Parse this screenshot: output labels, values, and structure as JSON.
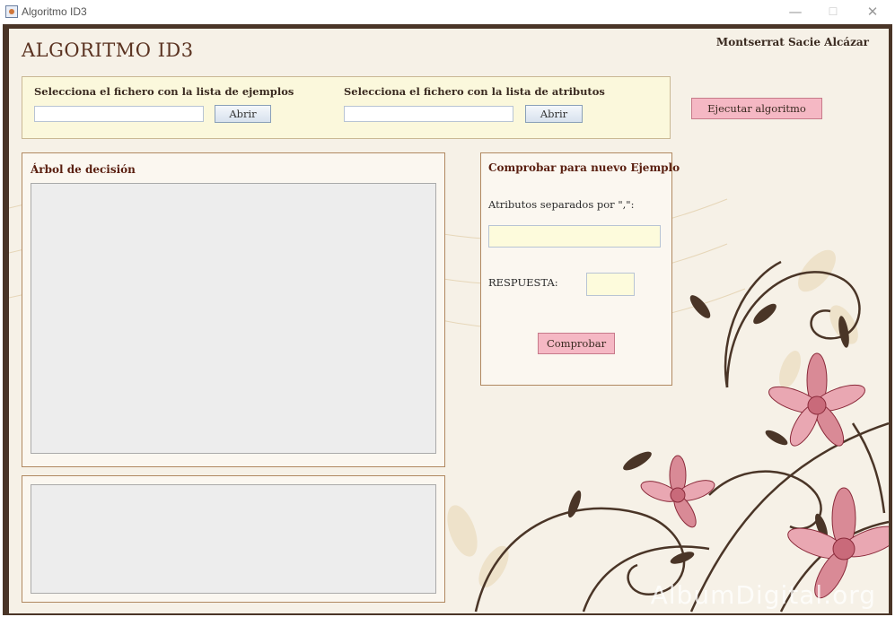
{
  "window": {
    "title": "Algoritmo ID3",
    "minimize": "—",
    "maximize": "☐",
    "close": "✕"
  },
  "app": {
    "title": "ALGORITMO ID3",
    "author": "Montserrat Sacie Alcázar"
  },
  "files": {
    "examples_label": "Selecciona el fichero  con la lista de ejemplos",
    "examples_value": "",
    "attributes_label": "Selecciona el fichero  con la lista de atributos",
    "attributes_value": "",
    "open_label": "Abrir"
  },
  "run_button": "Ejecutar algoritmo",
  "tree_panel": {
    "title": "Árbol de decisión"
  },
  "check_panel": {
    "title": "Comprobar para nuevo Ejemplo",
    "attributes_label": "Atributos separados por \",\":",
    "attributes_value": "",
    "answer_label": "RESPUESTA:",
    "answer_value": "",
    "check_button": "Comprobar"
  },
  "watermark": "AlbumDigital.org",
  "colors": {
    "frame": "#4a3527",
    "background": "#f6f1e7",
    "pink_button": "#f5b8c4",
    "title_brown": "#5a3220"
  }
}
